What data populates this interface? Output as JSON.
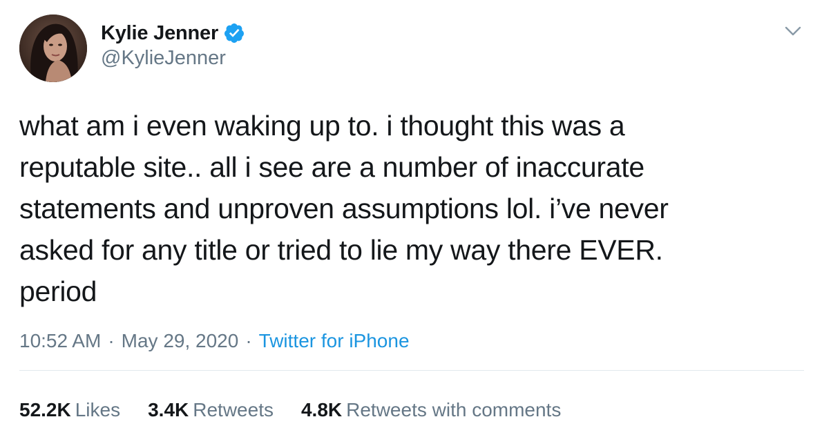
{
  "author": {
    "display_name": "Kylie Jenner",
    "handle": "@KylieJenner",
    "verified": true,
    "avatar": "profile-photo"
  },
  "tweet": {
    "lines": [
      "what am i even waking up to. i thought this was a",
      "reputable site.. all i see are a number of inaccurate",
      "statements and unproven assumptions lol. i’ve never",
      "asked for any title or tried to lie my way there EVER.",
      "period"
    ],
    "time": "10:52 AM",
    "date": "May 29, 2020",
    "separator": "·",
    "source": "Twitter for iPhone"
  },
  "stats": {
    "likes": {
      "count": "52.2K",
      "label": "Likes"
    },
    "retweets": {
      "count": "3.4K",
      "label": "Retweets"
    },
    "quotes": {
      "count": "4.8K",
      "label": "Retweets with comments"
    }
  },
  "icons": {
    "verified": "verified-badge-icon",
    "menu": "chevron-down-icon"
  },
  "colors": {
    "text": "#14171a",
    "secondary": "#657786",
    "link": "#1b95e0",
    "verified": "#1da1f2",
    "divider": "#e1e8ed"
  }
}
